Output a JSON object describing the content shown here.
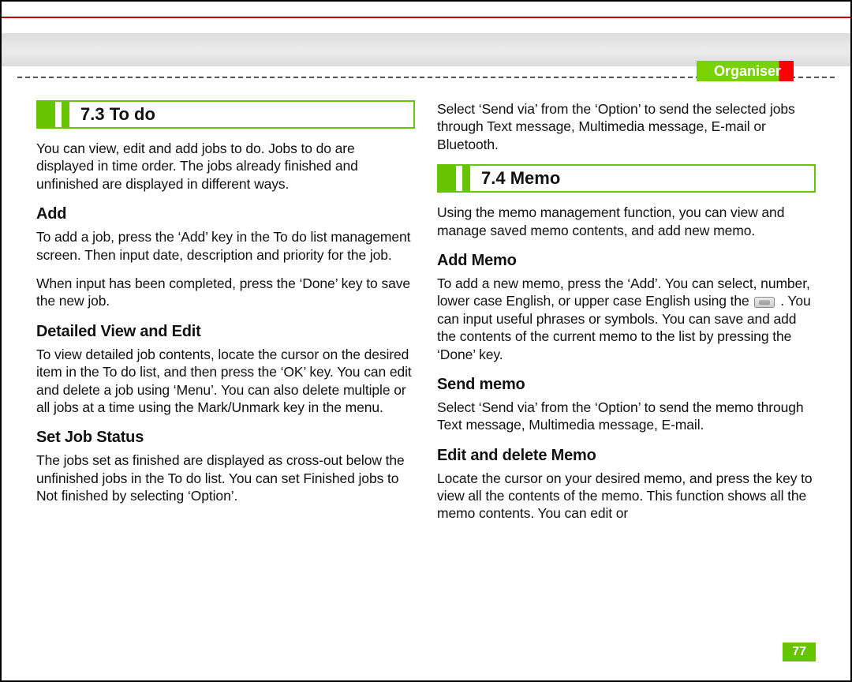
{
  "section_label": "Organiser",
  "page_number": "77",
  "left": {
    "band_title": "7.3 To do",
    "intro": "You can view, edit and add jobs to do. Jobs to do are displayed in time order. The jobs already finished and unfinished are displayed in different ways.",
    "h_add": "Add",
    "p_add_1": "To add a job, press the ‘Add’ key in the To do list management screen. Then input date, description  and priority for the job.",
    "p_add_2": "When input has been completed, press the ‘Done’ key to save the new job.",
    "h_detail": "Detailed View and Edit",
    "p_detail": "To view detailed job contents, locate the cursor on the desired item in the To do list, and then press the ‘OK’ key. You can edit and delete a job using ‘Menu’. You can also delete multiple or all jobs at a time using the Mark/Unmark key in the menu.",
    "h_status": "Set Job Status",
    "p_status": "The jobs set as finished are  displayed as cross-out below the unfinished jobs in the To do list. You can set Finished jobs to Not finished by selecting ‘Option’."
  },
  "right": {
    "p_top": "Select ‘Send via’ from the ‘Option’ to send the selected jobs through Text message, Multimedia message,  E-mail or Bluetooth.",
    "band_title": "7.4 Memo",
    "p_memo_intro": "Using the memo management function, you can view and manage saved memo contents, and add new memo.",
    "h_addmemo": "Add Memo",
    "p_addmemo_a": "To add a new memo, press the ‘Add’. You can select, number, lower case English, or upper case English using the ",
    "p_addmemo_b": " . You can input useful phrases or symbols. You can save and add the contents of the current memo to the list by pressing the ‘Done’ key.",
    "h_sendmemo": "Send memo",
    "p_sendmemo": "Select ‘Send via’ from the ‘Option’ to send the memo through Text message, Multimedia message, E-mail.",
    "h_editmemo": "Edit and delete Memo",
    "p_editmemo": "Locate the cursor on your desired memo, and press the key to view all the contents of the memo. This function shows all the memo contents. You can edit or"
  }
}
